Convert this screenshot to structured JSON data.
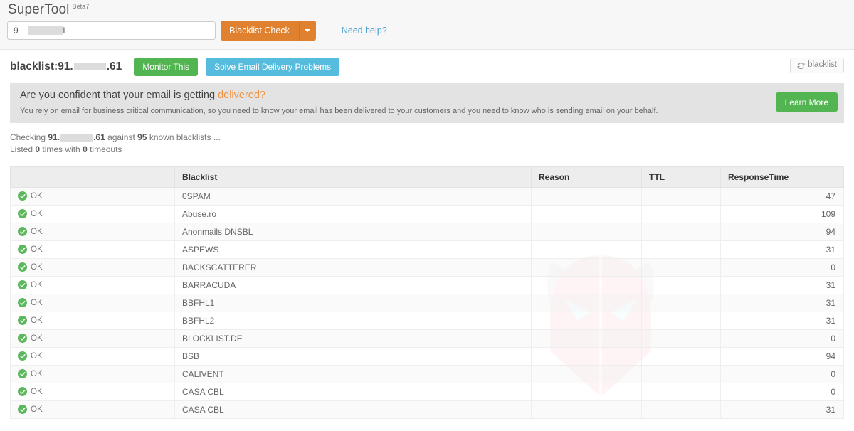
{
  "topbar": {
    "brand": "SuperTool",
    "beta": "Beta7",
    "search": {
      "value_prefix": "9",
      "value_suffix": "61",
      "placeholder": ""
    },
    "check_button": "Blacklist Check",
    "caret_icon": "chevron-down-icon",
    "need_help": "Need help?"
  },
  "result": {
    "title_prefix": "blacklist:91.",
    "title_suffix": ".61",
    "monitor_button": "Monitor This",
    "solve_button": "Solve Email Delivery Problems",
    "blacklist_refresh": "blacklist",
    "refresh_icon": "refresh-icon"
  },
  "promo": {
    "heading_main": "Are you confident that your email is getting ",
    "heading_accent": "delivered?",
    "body": "You rely on email for business critical communication, so you need to know your email has been delivered to your customers and you need to know who is sending email on your behalf.",
    "learn_more": "Learn More"
  },
  "status": {
    "checking_pre": "Checking ",
    "checking_ip_prefix": "91.",
    "checking_ip_suffix": ".61",
    "checking_mid": " against ",
    "blacklist_count": "95",
    "checking_post": " known blacklists ...",
    "listed_pre": "Listed ",
    "listed_count": "0",
    "listed_mid": " times with ",
    "timeout_count": "0",
    "listed_post": " timeouts"
  },
  "table": {
    "headers": {
      "status": "",
      "blacklist": "Blacklist",
      "reason": "Reason",
      "ttl": "TTL",
      "response_time": "ResponseTime"
    },
    "rows": [
      {
        "status": "OK",
        "blacklist": "0SPAM",
        "reason": "",
        "ttl": "",
        "response_time": "47"
      },
      {
        "status": "OK",
        "blacklist": "Abuse.ro",
        "reason": "",
        "ttl": "",
        "response_time": "109"
      },
      {
        "status": "OK",
        "blacklist": "Anonmails DNSBL",
        "reason": "",
        "ttl": "",
        "response_time": "94"
      },
      {
        "status": "OK",
        "blacklist": "ASPEWS",
        "reason": "",
        "ttl": "",
        "response_time": "31"
      },
      {
        "status": "OK",
        "blacklist": "BACKSCATTERER",
        "reason": "",
        "ttl": "",
        "response_time": "0"
      },
      {
        "status": "OK",
        "blacklist": "BARRACUDA",
        "reason": "",
        "ttl": "",
        "response_time": "31"
      },
      {
        "status": "OK",
        "blacklist": "BBFHL1",
        "reason": "",
        "ttl": "",
        "response_time": "31"
      },
      {
        "status": "OK",
        "blacklist": "BBFHL2",
        "reason": "",
        "ttl": "",
        "response_time": "31"
      },
      {
        "status": "OK",
        "blacklist": "BLOCKLIST.DE",
        "reason": "",
        "ttl": "",
        "response_time": "0"
      },
      {
        "status": "OK",
        "blacklist": "BSB",
        "reason": "",
        "ttl": "",
        "response_time": "94"
      },
      {
        "status": "OK",
        "blacklist": "CALIVENT",
        "reason": "",
        "ttl": "",
        "response_time": "0"
      },
      {
        "status": "OK",
        "blacklist": "CASA CBL",
        "reason": "",
        "ttl": "",
        "response_time": "0"
      },
      {
        "status": "OK",
        "blacklist": "CASA CBL",
        "reason": "",
        "ttl": "",
        "response_time": "31"
      }
    ]
  },
  "colors": {
    "orange": "#e0812f",
    "green": "#52b552",
    "blue": "#55bcdd",
    "accent_text": "#f0913f",
    "link": "#4c9fd1",
    "banner_bg": "#e3e3e3"
  }
}
